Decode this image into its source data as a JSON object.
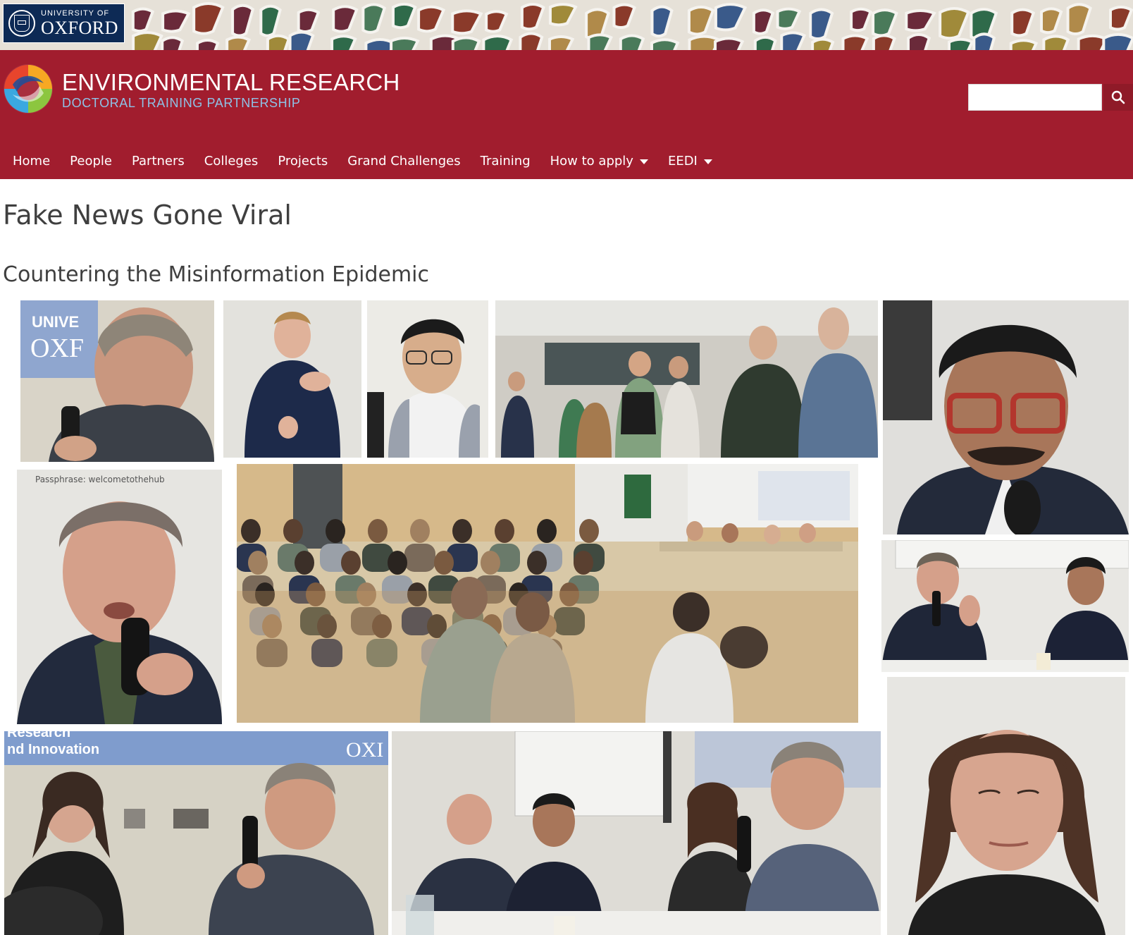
{
  "oxford_logo": {
    "line1": "UNIVERSITY OF",
    "line2": "OXFORD"
  },
  "site": {
    "title": "ENVIRONMENTAL RESEARCH",
    "subtitle": "DOCTORAL TRAINING PARTNERSHIP"
  },
  "search": {
    "value": "",
    "icon": "search-icon"
  },
  "nav": {
    "items": [
      {
        "label": "Home",
        "has_dropdown": false
      },
      {
        "label": "People",
        "has_dropdown": false
      },
      {
        "label": "Partners",
        "has_dropdown": false
      },
      {
        "label": "Colleges",
        "has_dropdown": false
      },
      {
        "label": "Projects",
        "has_dropdown": false
      },
      {
        "label": "Grand Challenges",
        "has_dropdown": false
      },
      {
        "label": "Training",
        "has_dropdown": false
      },
      {
        "label": "How to apply",
        "has_dropdown": true
      },
      {
        "label": "EEDI",
        "has_dropdown": true
      }
    ]
  },
  "page": {
    "title": "Fake News Gone Viral",
    "subtitle": "Countering the Misinformation Epidemic"
  },
  "photo_labels": {
    "banner_univ": "UNIVE",
    "banner_oxf": "OXF",
    "passphrase": "Passphrase: welcometothehub",
    "research_line1": "Research",
    "research_line2": "nd Innovation",
    "oxf_partial": "OXI"
  },
  "colors": {
    "header_red": "#a11d2e",
    "oxford_blue": "#0d2a55",
    "subtitle_blue": "#8ec2e6",
    "heading_grey": "#3f3f3f"
  }
}
